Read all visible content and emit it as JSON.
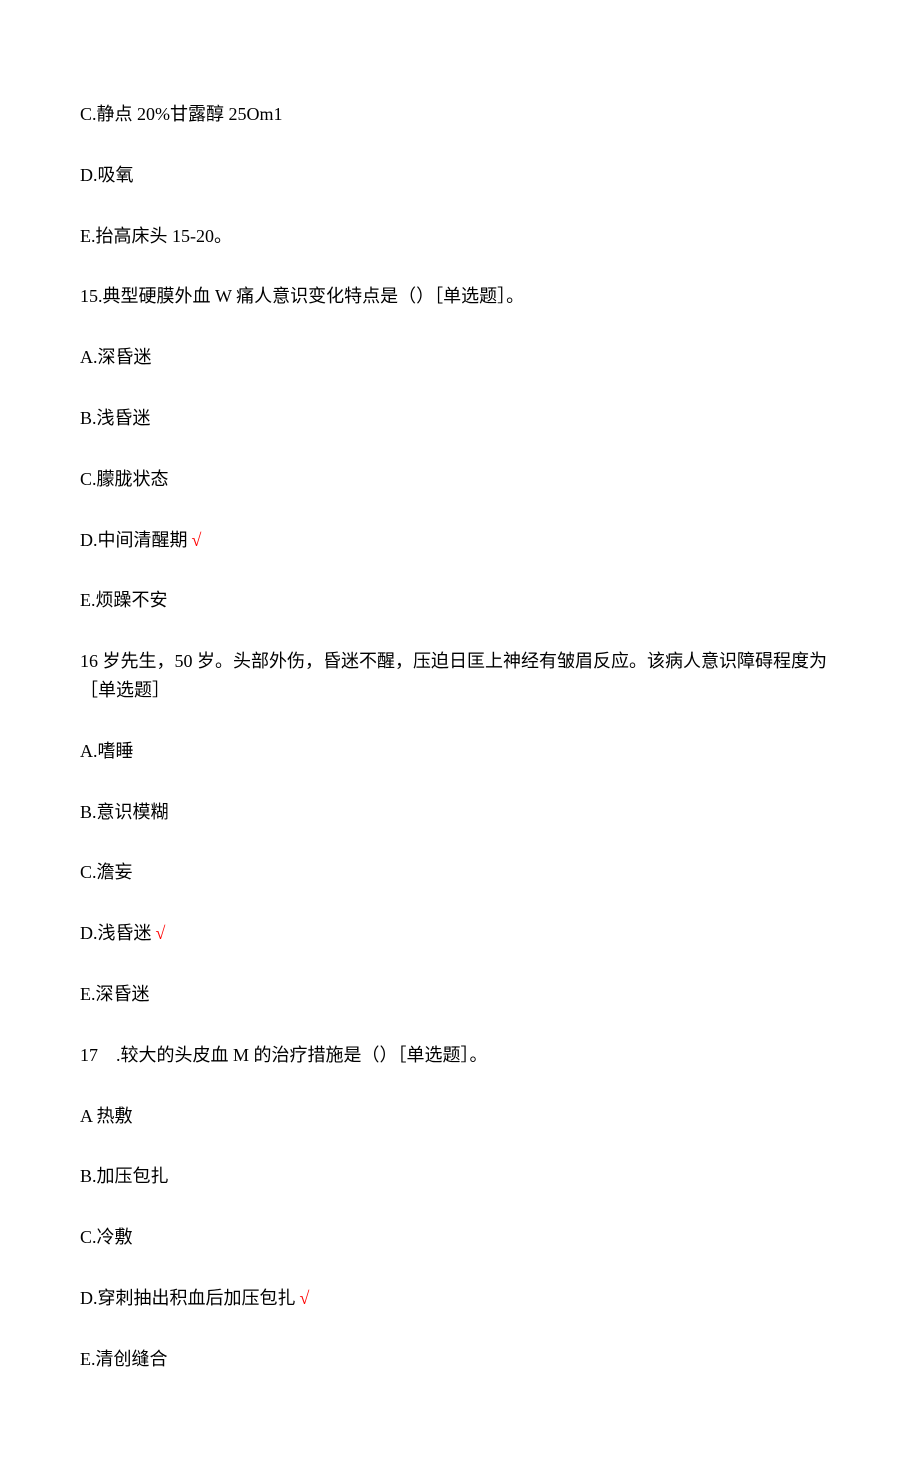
{
  "lines": [
    {
      "text": "C.静点 20%甘露醇 25Om1",
      "correct": false
    },
    {
      "text": "D.吸氧",
      "correct": false
    },
    {
      "text": "E.抬高床头 15-20。",
      "correct": false
    },
    {
      "text": "15.典型硬膜外血 W 痛人意识变化特点是（）［单选题］。",
      "correct": false
    },
    {
      "text": "A.深昏迷",
      "correct": false
    },
    {
      "text": "B.浅昏迷",
      "correct": false
    },
    {
      "text": "C.朦胧状态",
      "correct": false
    },
    {
      "text": "D.中间清醒期",
      "correct": true
    },
    {
      "text": "E.烦躁不安",
      "correct": false
    },
    {
      "text": "16 岁先生，50 岁。头部外伤，昏迷不醒，压迫日匡上神经有皱眉反应。该病人意识障碍程度为［单选题］",
      "correct": false
    },
    {
      "text": "",
      "correct": false
    },
    {
      "text": "A.嗜睡",
      "correct": false
    },
    {
      "text": "B.意识模糊",
      "correct": false
    },
    {
      "text": "C.澹妄",
      "correct": false
    },
    {
      "text": "D.浅昏迷",
      "correct": true
    },
    {
      "text": "E.深昏迷",
      "correct": false
    },
    {
      "text": "17　.较大的头皮血 M 的治疗措施是（）［单选题］。",
      "correct": false
    },
    {
      "text": "A 热敷",
      "correct": false
    },
    {
      "text": "B.加压包扎",
      "correct": false
    },
    {
      "text": "C.冷敷",
      "correct": false
    },
    {
      "text": "D.穿刺抽出积血后加压包扎",
      "correct": true
    },
    {
      "text": "E.清创缝合",
      "correct": false
    }
  ],
  "checkmark": "√"
}
